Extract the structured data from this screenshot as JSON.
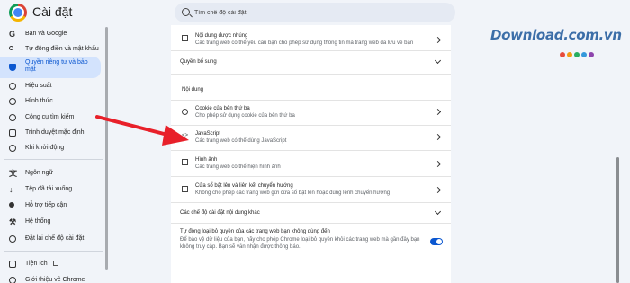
{
  "header": {
    "app_title": "Cài đặt",
    "search_placeholder": "Tìm chế độ cài đặt"
  },
  "watermark": {
    "text": "Download.com.vn",
    "dot_colors": [
      "#e74c3c",
      "#f39c12",
      "#27ae60",
      "#3498db",
      "#8e44ad"
    ]
  },
  "sidebar": {
    "items": [
      {
        "label": "Bạn và Google",
        "icon": "google-icon"
      },
      {
        "label": "Tự động điền và mật khẩu",
        "icon": "key-icon"
      },
      {
        "label": "Quyền riêng tư và bảo mật",
        "icon": "shield-icon",
        "active": true
      },
      {
        "label": "Hiệu suất",
        "icon": "speedometer-icon"
      },
      {
        "label": "Hình thức",
        "icon": "palette-icon"
      },
      {
        "label": "Công cụ tìm kiếm",
        "icon": "search-icon"
      },
      {
        "label": "Trình duyệt mặc định",
        "icon": "browser-icon"
      },
      {
        "label": "Khi khởi động",
        "icon": "power-icon"
      },
      {
        "label": "Ngôn ngữ",
        "icon": "translate-icon"
      },
      {
        "label": "Tệp đã tải xuống",
        "icon": "download-icon"
      },
      {
        "label": "Hỗ trợ tiếp cận",
        "icon": "accessibility-icon"
      },
      {
        "label": "Hệ thống",
        "icon": "wrench-icon"
      },
      {
        "label": "Đặt lại chế độ cài đặt",
        "icon": "reset-icon"
      },
      {
        "label": "Tiện ích",
        "icon": "puzzle-icon"
      },
      {
        "label": "Giới thiệu về Chrome",
        "icon": "chrome-icon"
      }
    ]
  },
  "content": {
    "embedded": {
      "title": "Nội dung được nhúng",
      "subtitle": "Các trang web có thể yêu cầu bạn cho phép sử dụng thông tin mà trang web đã lưu về bạn"
    },
    "additional_permissions": "Quyền bổ sung",
    "content_section": "Nội dung",
    "cookies": {
      "title": "Cookie của bên thứ ba",
      "subtitle": "Cho phép sử dụng cookie của bên thứ ba"
    },
    "javascript": {
      "title": "JavaScript",
      "subtitle": "Các trang web có thể dùng JavaScript"
    },
    "images": {
      "title": "Hình ảnh",
      "subtitle": "Các trang web có thể hiện hình ảnh"
    },
    "popups": {
      "title": "Cửa sổ bật lên và liên kết chuyển hướng",
      "subtitle": "Không cho phép các trang web gửi cửa sổ bật lên hoặc dùng lệnh chuyển hướng"
    },
    "other_settings": "Các chế độ cài đặt nội dung khác",
    "auto_revoke": {
      "title": "Tự động loại bỏ quyền của các trang web bạn không dùng đến",
      "subtitle_1": "Để bảo vệ dữ liệu của bạn, hãy cho phép Chrome loại bỏ quyền khỏi các trang web mà gần đây bạn",
      "subtitle_2": "không truy cập. Bạn sẽ vẫn nhận được thông báo.",
      "enabled": true
    }
  }
}
